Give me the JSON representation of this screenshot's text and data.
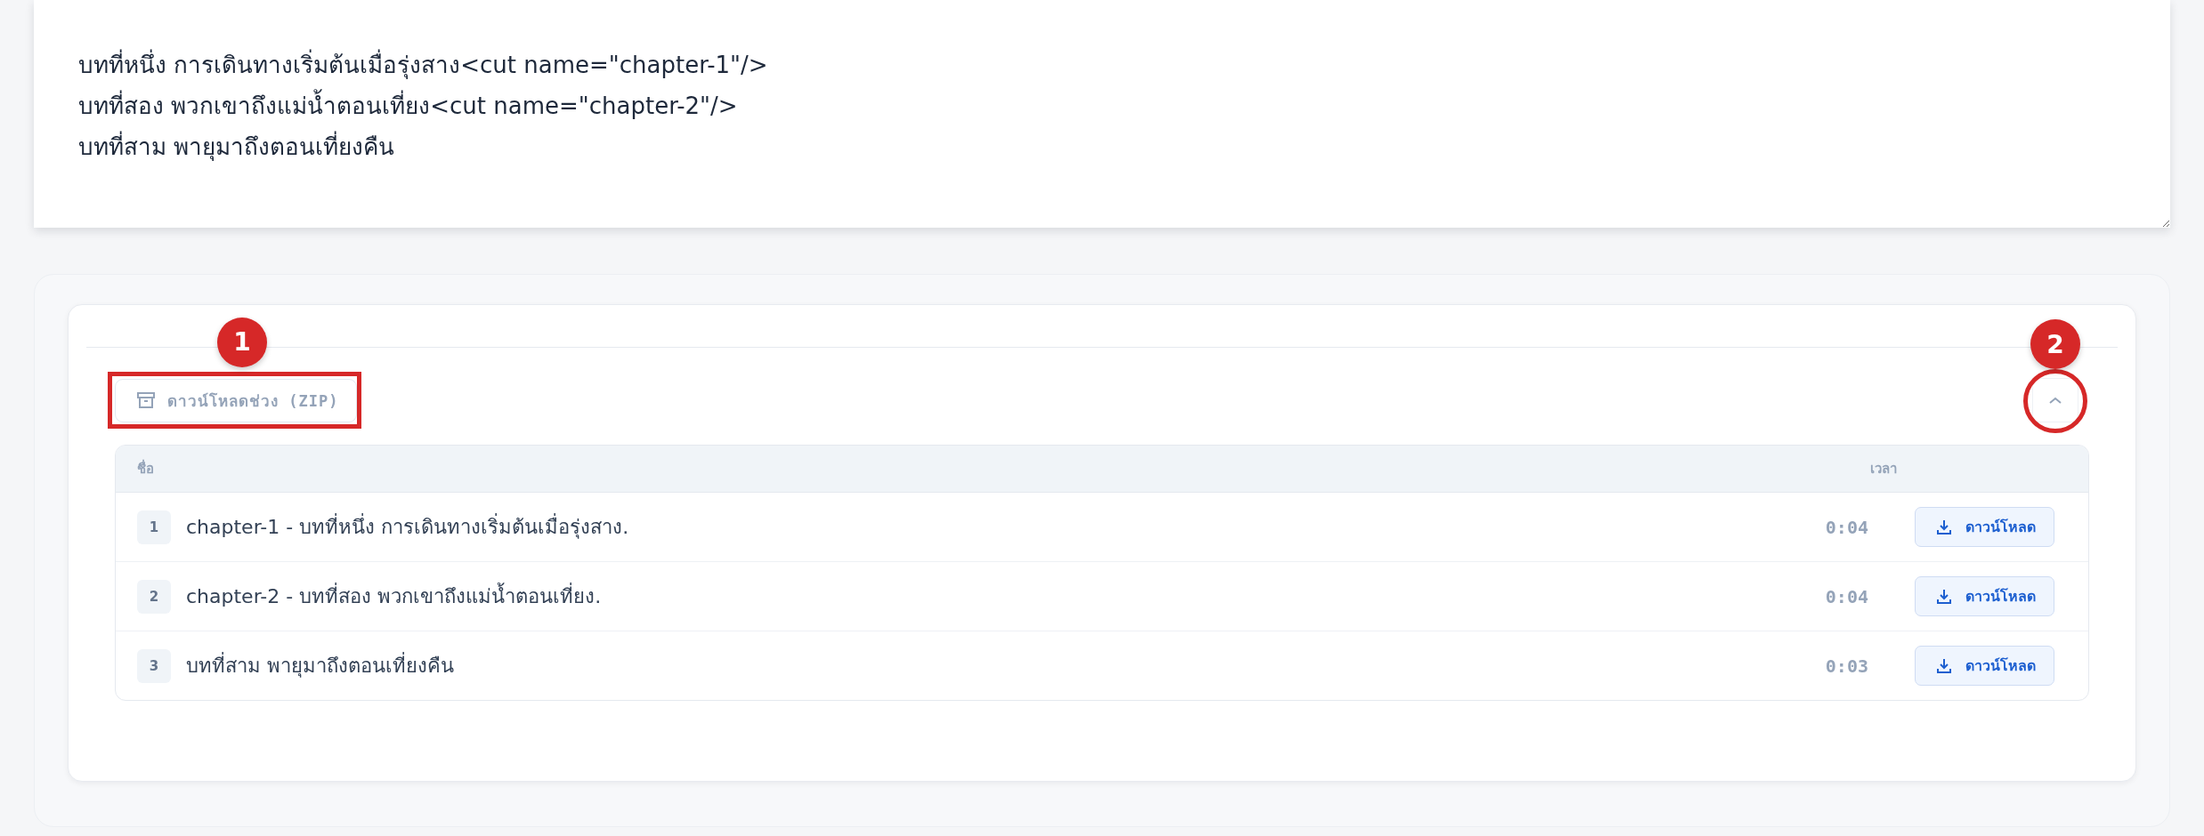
{
  "editor": {
    "value": "บทที่หนึ่ง การเดินทางเริ่มต้นเมื่อรุ่งสาง<cut name=\"chapter-1\"/>\nบทที่สอง พวกเขาถึงแม่น้ำตอนเที่ยง<cut name=\"chapter-2\"/>\nบทที่สาม พายุมาถึงตอนเที่ยงคืน"
  },
  "export_panel": {
    "zip_button": "ดาวน์โหลดช่วง (ZIP)",
    "expanded": true,
    "table": {
      "columns": [
        "ชื่อ",
        "เวลา"
      ],
      "rows": [
        {
          "index": "1",
          "title": "chapter-1 - บทที่หนึ่ง การเดินทางเริ่มต้นเมื่อรุ่งสาง.",
          "duration": "0:04",
          "button": "ดาวน์โหลด"
        },
        {
          "index": "2",
          "title": "chapter-2 - บทที่สอง พวกเขาถึงแม่น้ำตอนเที่ยง.",
          "duration": "0:04",
          "button": "ดาวน์โหลด"
        },
        {
          "index": "3",
          "title": "บทที่สาม พายุมาถึงตอนเที่ยงคืน",
          "duration": "0:03",
          "button": "ดาวน์โหลด"
        }
      ]
    }
  },
  "annotations": [
    {
      "label": "1",
      "kind": "box"
    },
    {
      "label": "2",
      "kind": "circle"
    }
  ]
}
